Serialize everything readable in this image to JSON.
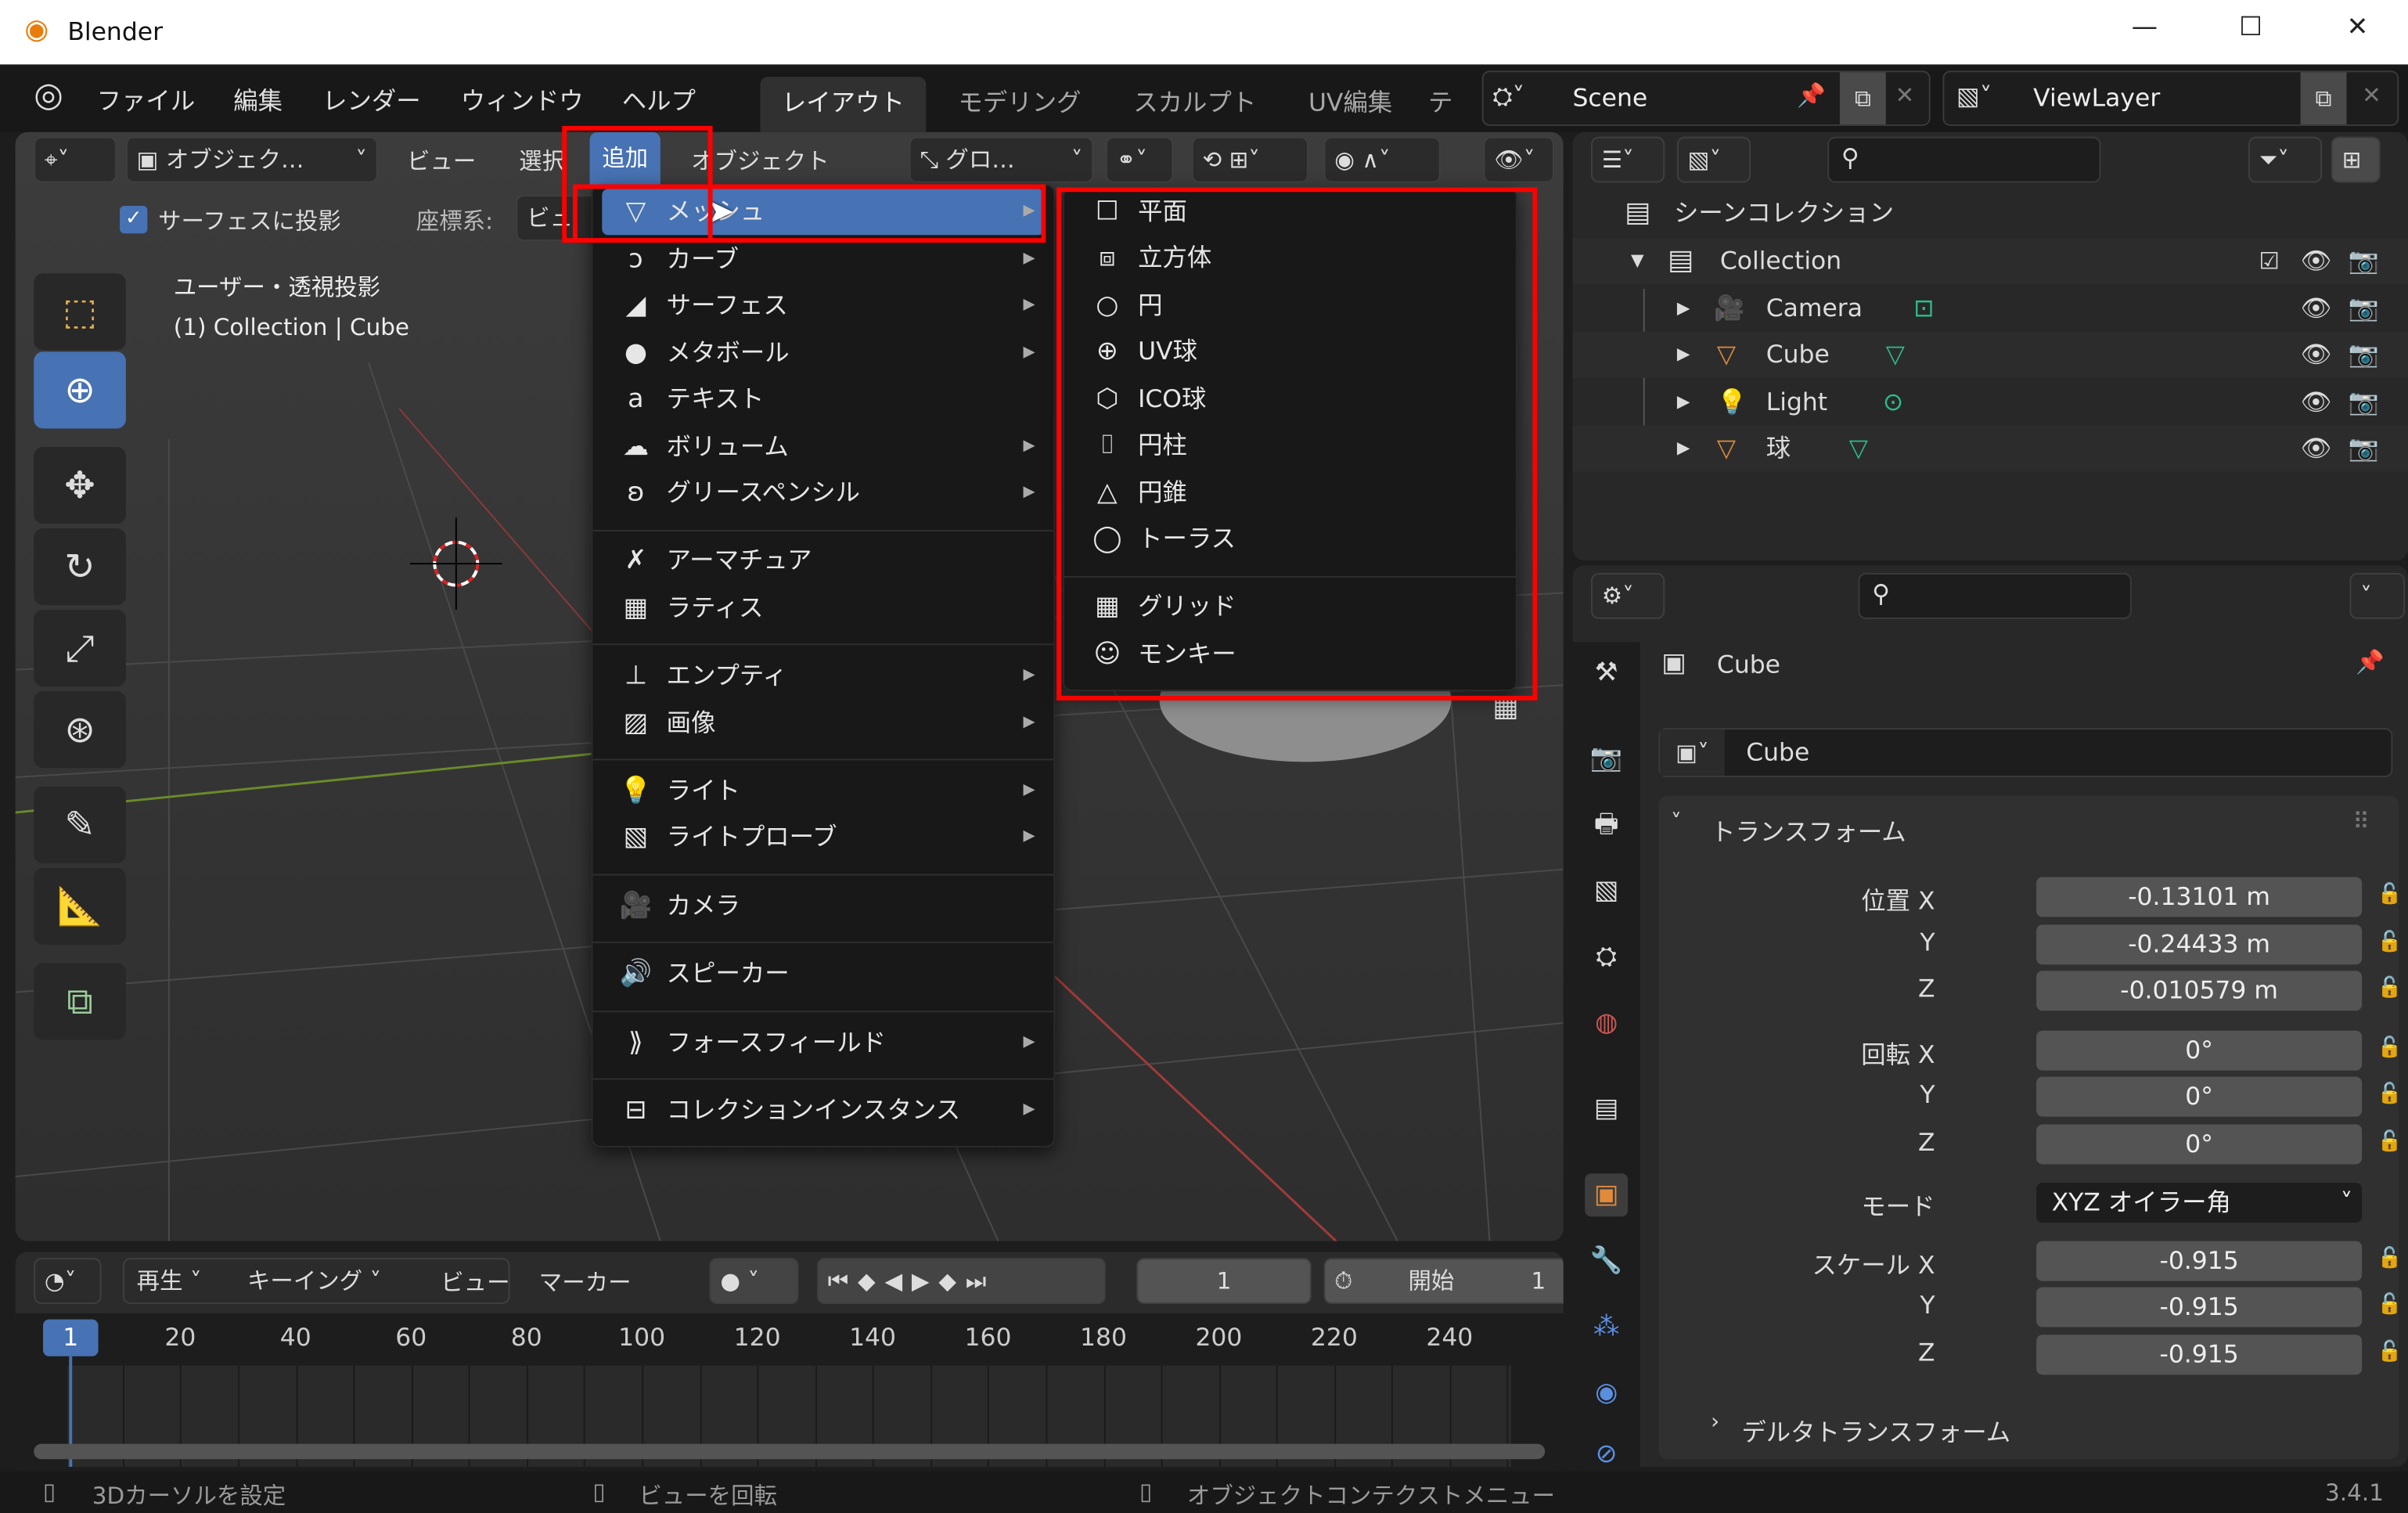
{
  "window": {
    "title": "Blender",
    "version": "3.4.1"
  },
  "menubar": {
    "items": [
      "ファイル",
      "編集",
      "レンダー",
      "ウィンドウ",
      "ヘルプ"
    ]
  },
  "workspaces": {
    "tabs": [
      "レイアウト",
      "モデリング",
      "スカルプト",
      "UV編集",
      "テ"
    ],
    "active": "レイアウト"
  },
  "scene": {
    "name": "Scene",
    "view_layer": "ViewLayer"
  },
  "viewport": {
    "header": {
      "mode": "オブジェク…",
      "view": "ビュー",
      "select": "選択",
      "add": "追加",
      "object": "オブジェクト",
      "transform_orientation": "グロ…"
    },
    "options": {
      "project_surface": "サーフェスに投影",
      "project_surface_checked": true,
      "coord_label": "座標系:",
      "coord_value": "ビュ"
    },
    "overlay": {
      "view_name": "ユーザー・透視投影",
      "context": "(1) Collection | Cube"
    }
  },
  "add_menu": {
    "items": [
      {
        "label": "メッシュ",
        "icon": "mesh-icon",
        "submenu": true,
        "active": true
      },
      {
        "label": "カーブ",
        "icon": "curve-icon",
        "submenu": true
      },
      {
        "label": "サーフェス",
        "icon": "surface-icon",
        "submenu": true
      },
      {
        "label": "メタボール",
        "icon": "metaball-icon",
        "submenu": true
      },
      {
        "label": "テキスト",
        "icon": "text-icon",
        "submenu": false
      },
      {
        "label": "ボリューム",
        "icon": "volume-icon",
        "submenu": true
      },
      {
        "label": "グリースペンシル",
        "icon": "grease-pencil-icon",
        "submenu": true
      },
      {
        "label": "アーマチュア",
        "icon": "armature-icon",
        "submenu": false
      },
      {
        "label": "ラティス",
        "icon": "lattice-icon",
        "submenu": false
      },
      {
        "label": "エンプティ",
        "icon": "empty-icon",
        "submenu": true
      },
      {
        "label": "画像",
        "icon": "image-icon",
        "submenu": true
      },
      {
        "label": "ライト",
        "icon": "light-icon",
        "submenu": true
      },
      {
        "label": "ライトプローブ",
        "icon": "light-probe-icon",
        "submenu": true
      },
      {
        "label": "カメラ",
        "icon": "camera-icon",
        "submenu": false
      },
      {
        "label": "スピーカー",
        "icon": "speaker-icon",
        "submenu": false
      },
      {
        "label": "フォースフィールド",
        "icon": "force-field-icon",
        "submenu": true
      },
      {
        "label": "コレクションインスタンス",
        "icon": "collection-instance-icon",
        "submenu": true
      }
    ]
  },
  "mesh_submenu": {
    "items": [
      {
        "label": "平面",
        "icon": "plane-icon"
      },
      {
        "label": "立方体",
        "icon": "cube-icon"
      },
      {
        "label": "円",
        "icon": "circle-icon"
      },
      {
        "label": "UV球",
        "icon": "uv-sphere-icon"
      },
      {
        "label": "ICO球",
        "icon": "ico-sphere-icon"
      },
      {
        "label": "円柱",
        "icon": "cylinder-icon"
      },
      {
        "label": "円錐",
        "icon": "cone-icon"
      },
      {
        "label": "トーラス",
        "icon": "torus-icon"
      },
      {
        "label": "グリッド",
        "icon": "grid-icon"
      },
      {
        "label": "モンキー",
        "icon": "monkey-icon"
      }
    ]
  },
  "outliner": {
    "root": "シーンコレクション",
    "collection": "Collection",
    "objects": [
      {
        "name": "Camera",
        "type": "camera"
      },
      {
        "name": "Cube",
        "type": "mesh"
      },
      {
        "name": "Light",
        "type": "light"
      },
      {
        "name": "球",
        "type": "mesh"
      }
    ]
  },
  "properties": {
    "object_name": "Cube",
    "data_name": "Cube",
    "transform_label": "トランスフォーム",
    "location_label": "位置 X",
    "rotation_label": "回転 X",
    "scale_label": "スケール X",
    "y_label": "Y",
    "z_label": "Z",
    "mode_label": "モード",
    "location": [
      "-0.13101 m",
      "-0.24433 m",
      "-0.010579 m"
    ],
    "rotation": [
      "0°",
      "0°",
      "0°"
    ],
    "rotation_mode": "XYZ オイラー角",
    "scale": [
      "-0.915",
      "-0.915",
      "-0.915"
    ],
    "delta_transform": "デルタトランスフォーム"
  },
  "timeline": {
    "playback": "再生",
    "keying": "キーイング",
    "view": "ビュー",
    "marker": "マーカー",
    "current_frame": "1",
    "start_label": "開始",
    "start_value": "1",
    "playhead": "1",
    "ticks": [
      "20",
      "40",
      "60",
      "80",
      "100",
      "120",
      "140",
      "160",
      "180",
      "200",
      "220",
      "240"
    ]
  },
  "statusbar": {
    "left": "3Dカーソルを設定",
    "middle": "ビューを回転",
    "right": "オブジェクトコンテクストメニュー"
  },
  "colors": {
    "accent": "#4772b3",
    "highlight_box": "#ff0000",
    "object_orange": "#e08a3c",
    "data_green": "#2bbd8e"
  }
}
